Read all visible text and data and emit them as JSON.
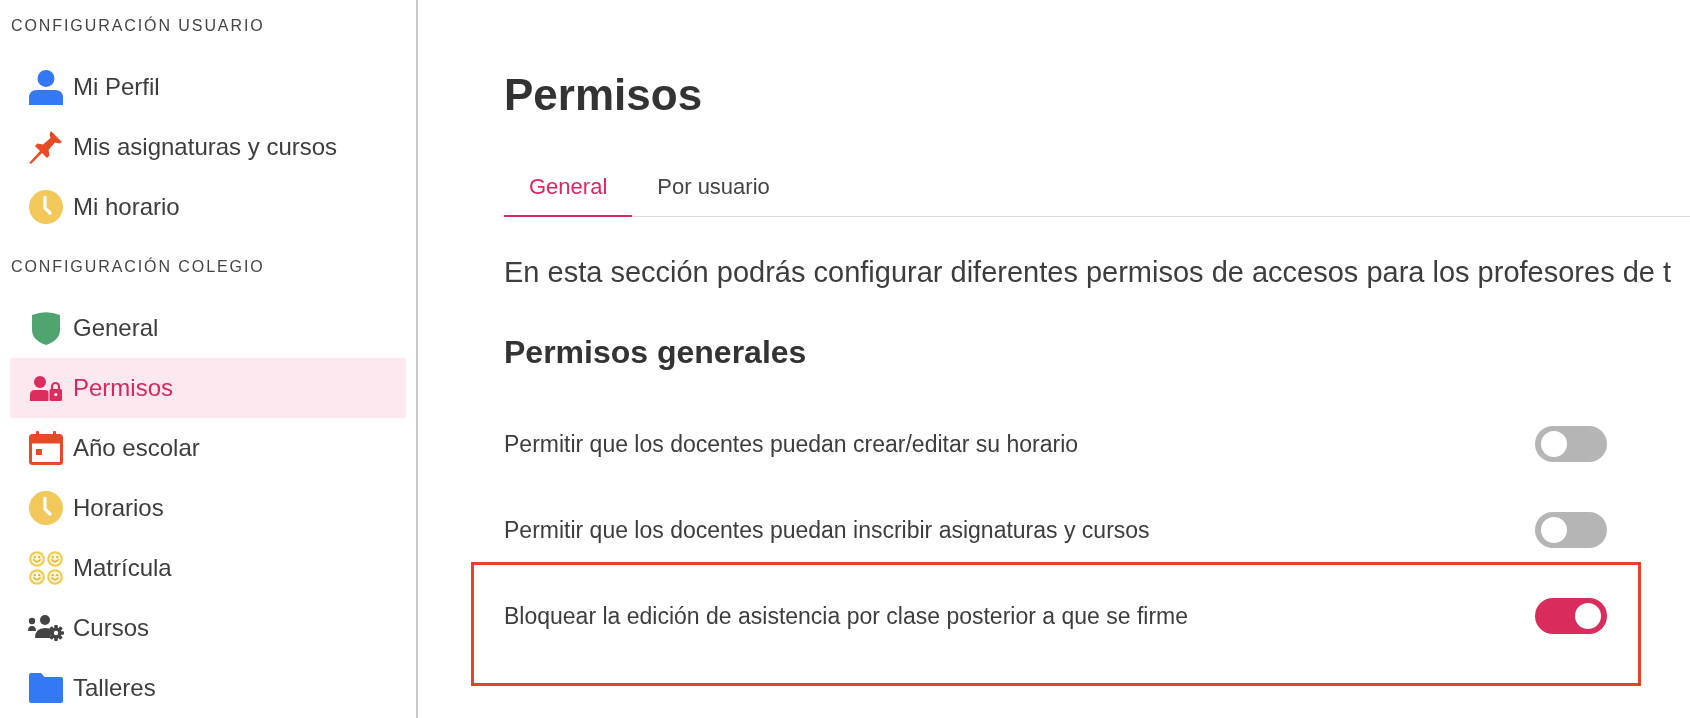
{
  "sidebar": {
    "sections": [
      {
        "title": "CONFIGURACIÓN USUARIO",
        "items": [
          {
            "label": "Mi Perfil",
            "selected": false
          },
          {
            "label": "Mis asignaturas y cursos",
            "selected": false
          },
          {
            "label": "Mi horario",
            "selected": false
          }
        ]
      },
      {
        "title": "CONFIGURACIÓN COLEGIO",
        "items": [
          {
            "label": "General",
            "selected": false
          },
          {
            "label": "Permisos",
            "selected": true
          },
          {
            "label": "Año escolar",
            "selected": false
          },
          {
            "label": "Horarios",
            "selected": false
          },
          {
            "label": "Matrícula",
            "selected": false
          },
          {
            "label": "Cursos",
            "selected": false
          },
          {
            "label": "Talleres",
            "selected": false
          }
        ]
      }
    ]
  },
  "main": {
    "title": "Permisos",
    "tabs": [
      {
        "label": "General",
        "selected": true
      },
      {
        "label": "Por usuario",
        "selected": false
      }
    ],
    "description": "En esta sección podrás configurar diferentes permisos de accesos para los profesores de t",
    "section_title": "Permisos generales",
    "permissions": [
      {
        "label": "Permitir que los docentes puedan crear/editar su horario",
        "on": false,
        "highlighted": false
      },
      {
        "label": "Permitir que los docentes puedan inscribir asignaturas y cursos",
        "on": false,
        "highlighted": false
      },
      {
        "label": "Bloquear la edición de asistencia por clase posterior a que se firme",
        "on": true,
        "highlighted": true
      }
    ]
  }
}
